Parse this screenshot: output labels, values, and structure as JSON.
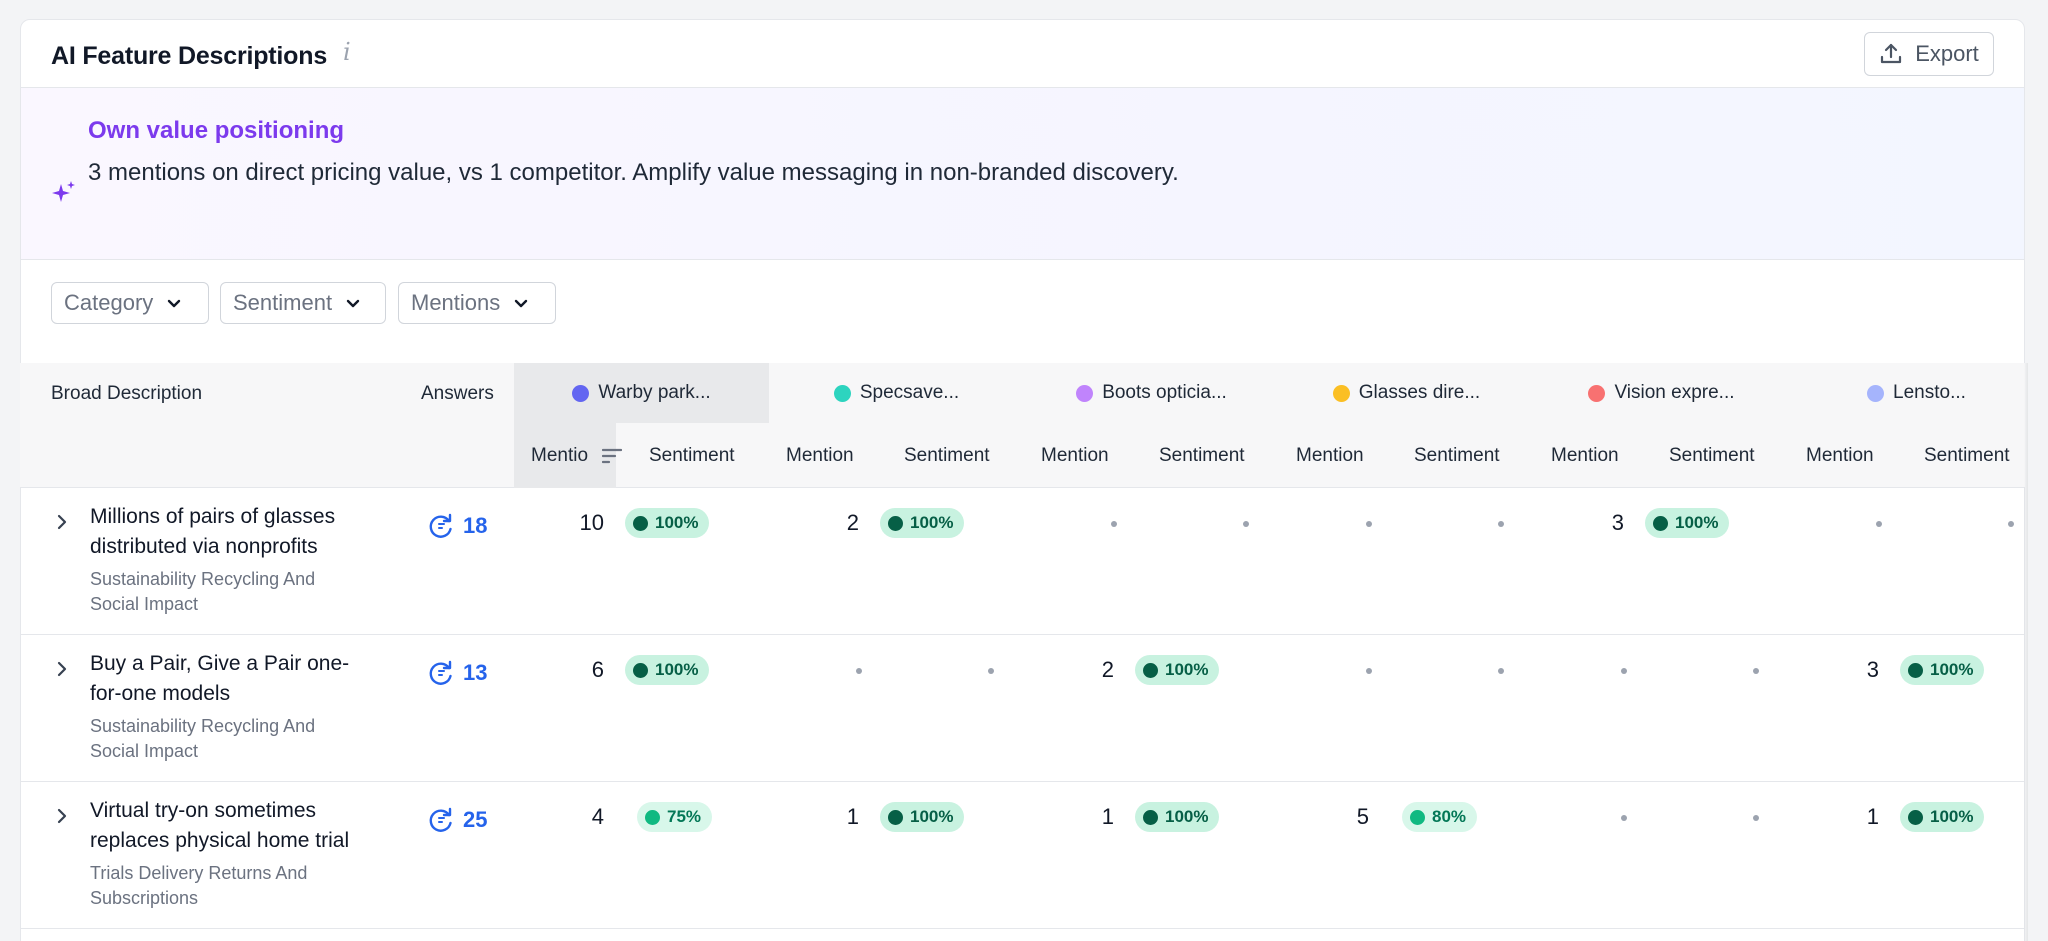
{
  "header": {
    "title": "AI Feature Descriptions",
    "info_glyph": "i",
    "export_label": "Export"
  },
  "insight": {
    "title": "Own value positioning",
    "text": "3 mentions on direct pricing value, vs 1 competitor. Amplify value messaging in non-branded discovery."
  },
  "filters": {
    "category": "Category",
    "sentiment": "Sentiment",
    "mentions": "Mentions"
  },
  "table": {
    "col_description": "Broad Description",
    "col_answers": "Answers",
    "sub_mention": "Mention",
    "sub_mention_active": "Mentio",
    "sub_sentiment": "Sentiment",
    "competitors": [
      {
        "name": "Warby park...",
        "color": "#6366f1"
      },
      {
        "name": "Specsave...",
        "color": "#2dd4bf"
      },
      {
        "name": "Boots opticia...",
        "color": "#c084fc"
      },
      {
        "name": "Glasses dire...",
        "color": "#fbbf24"
      },
      {
        "name": "Vision expre...",
        "color": "#f87171"
      },
      {
        "name": "Lensto...",
        "color": "#a5b4fc"
      }
    ],
    "rows": [
      {
        "description": "Millions of pairs of glasses distributed via nonprofits",
        "category": "Sustainability Recycling And Social Impact",
        "answers": "18",
        "cells": [
          {
            "mention": "10",
            "sentiment": "100%"
          },
          {
            "mention": "2",
            "sentiment": "100%"
          },
          null,
          null,
          {
            "mention": "3",
            "sentiment": "100%"
          },
          null
        ]
      },
      {
        "description": "Buy a Pair, Give a Pair one-for-one models",
        "category": "Sustainability Recycling And Social Impact",
        "answers": "13",
        "cells": [
          {
            "mention": "6",
            "sentiment": "100%"
          },
          null,
          {
            "mention": "2",
            "sentiment": "100%"
          },
          null,
          null,
          {
            "mention": "3",
            "sentiment": "100%"
          }
        ]
      },
      {
        "description": "Virtual try-on sometimes replaces physical home trial",
        "category": "Trials Delivery Returns And Subscriptions",
        "answers": "25",
        "cells": [
          {
            "mention": "4",
            "sentiment": "75%"
          },
          {
            "mention": "1",
            "sentiment": "100%"
          },
          {
            "mention": "1",
            "sentiment": "100%"
          },
          {
            "mention": "5",
            "sentiment": "80%"
          },
          null,
          {
            "mention": "1",
            "sentiment": "100%"
          }
        ]
      }
    ]
  },
  "icons": {
    "info": "info-icon",
    "export": "upload-icon",
    "sparkle": "sparkle-icon",
    "dropdown": "chevron-down-icon",
    "expand": "chevron-right-icon",
    "answers": "refresh-icon",
    "sort": "sort-icon"
  }
}
